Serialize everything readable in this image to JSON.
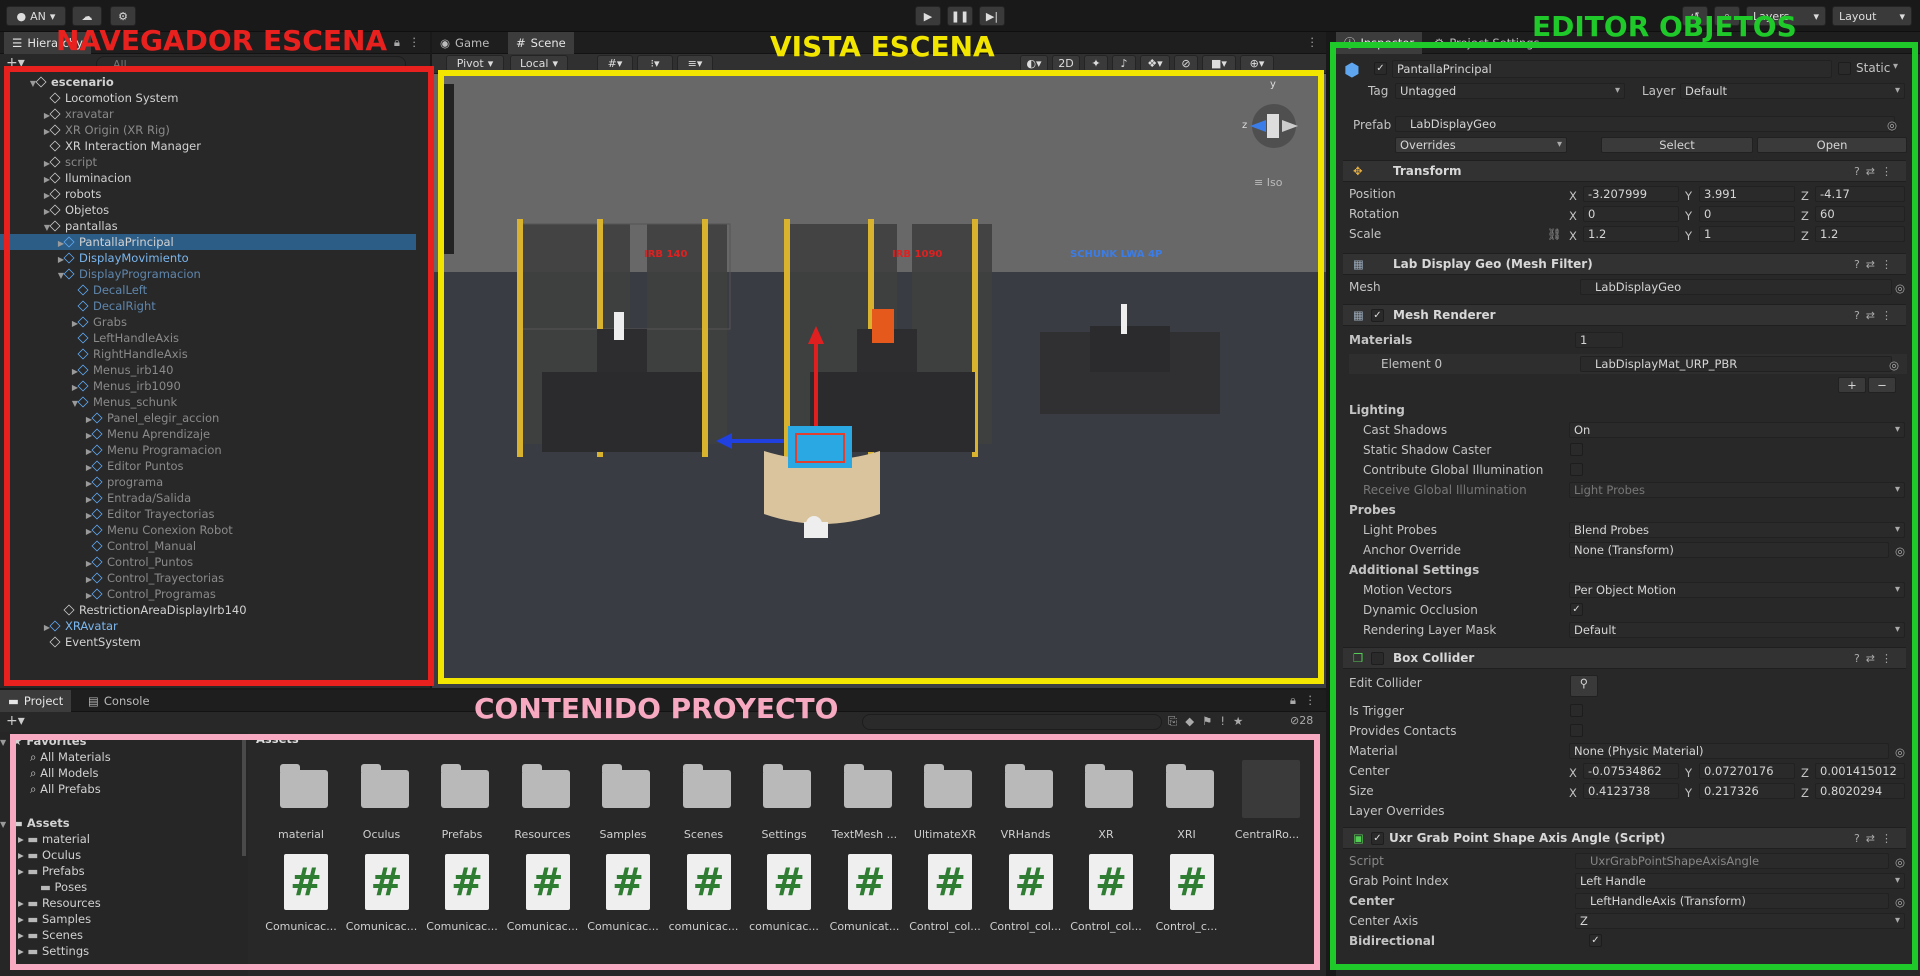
{
  "toolbar": {
    "account": "AN",
    "layers": "Layers",
    "layout": "Layout"
  },
  "hierarchy": {
    "tab": "Hierarchy",
    "search_placeholder": "All",
    "rows": [
      {
        "label": "escenario",
        "depth": 0,
        "style": "root",
        "arrow": "▼"
      },
      {
        "label": "Locomotion System",
        "depth": 1,
        "style": "",
        "arrow": ""
      },
      {
        "label": "xravatar",
        "depth": 1,
        "style": "dim",
        "arrow": "▶"
      },
      {
        "label": "XR Origin (XR Rig)",
        "depth": 1,
        "style": "dim",
        "arrow": "▶"
      },
      {
        "label": "XR Interaction Manager",
        "depth": 1,
        "style": "",
        "arrow": ""
      },
      {
        "label": "script",
        "depth": 1,
        "style": "dim",
        "arrow": "▶"
      },
      {
        "label": "Iluminacion",
        "depth": 1,
        "style": "",
        "arrow": "▶"
      },
      {
        "label": "robots",
        "depth": 1,
        "style": "",
        "arrow": "▶"
      },
      {
        "label": "Objetos",
        "depth": 1,
        "style": "",
        "arrow": "▶"
      },
      {
        "label": "pantallas",
        "depth": 1,
        "style": "",
        "arrow": "▼"
      },
      {
        "label": "PantallaPrincipal",
        "depth": 2,
        "style": "sel",
        "arrow": "▶"
      },
      {
        "label": "DisplayMovimiento",
        "depth": 2,
        "style": "pref",
        "arrow": "▶"
      },
      {
        "label": "DisplayProgramacion",
        "depth": 2,
        "style": "pdim",
        "arrow": "▼"
      },
      {
        "label": "DecalLeft",
        "depth": 3,
        "style": "pdim",
        "arrow": ""
      },
      {
        "label": "DecalRight",
        "depth": 3,
        "style": "pdim",
        "arrow": ""
      },
      {
        "label": "Grabs",
        "depth": 3,
        "style": "dim",
        "arrow": "▶"
      },
      {
        "label": "LeftHandleAxis",
        "depth": 3,
        "style": "dim",
        "arrow": ""
      },
      {
        "label": "RightHandleAxis",
        "depth": 3,
        "style": "dim",
        "arrow": ""
      },
      {
        "label": "Menus_irb140",
        "depth": 3,
        "style": "dim",
        "arrow": "▶"
      },
      {
        "label": "Menus_irb1090",
        "depth": 3,
        "style": "dim",
        "arrow": "▶"
      },
      {
        "label": "Menus_schunk",
        "depth": 3,
        "style": "dim",
        "arrow": "▼"
      },
      {
        "label": "Panel_elegir_accion",
        "depth": 4,
        "style": "dim",
        "arrow": "▶"
      },
      {
        "label": "Menu Aprendizaje",
        "depth": 4,
        "style": "dim",
        "arrow": "▶"
      },
      {
        "label": "Menu Programacion",
        "depth": 4,
        "style": "dim",
        "arrow": "▶"
      },
      {
        "label": "Editor Puntos",
        "depth": 4,
        "style": "dim",
        "arrow": "▶"
      },
      {
        "label": "programa",
        "depth": 4,
        "style": "dim",
        "arrow": "▶"
      },
      {
        "label": "Entrada/Salida",
        "depth": 4,
        "style": "dim",
        "arrow": "▶"
      },
      {
        "label": "Editor Trayectorias",
        "depth": 4,
        "style": "dim",
        "arrow": "▶"
      },
      {
        "label": "Menu Conexion Robot",
        "depth": 4,
        "style": "dim",
        "arrow": "▶"
      },
      {
        "label": "Control_Manual",
        "depth": 4,
        "style": "dim",
        "arrow": ""
      },
      {
        "label": "Control_Puntos",
        "depth": 4,
        "style": "dim",
        "arrow": "▶"
      },
      {
        "label": "Control_Trayectorias",
        "depth": 4,
        "style": "dim",
        "arrow": "▶"
      },
      {
        "label": "Control_Programas",
        "depth": 4,
        "style": "dim",
        "arrow": "▶"
      },
      {
        "label": "RestrictionAreaDisplayIrb140",
        "depth": 2,
        "style": "",
        "arrow": ""
      },
      {
        "label": "XRAvatar",
        "depth": 1,
        "style": "pref",
        "arrow": "▶"
      },
      {
        "label": "EventSystem",
        "depth": 1,
        "style": "",
        "arrow": ""
      }
    ]
  },
  "scene": {
    "tab_game": "Game",
    "tab_scene": "Scene",
    "pivot": "Pivot",
    "local": "Local",
    "mode_2d": "2D",
    "iso": "Iso",
    "gizmo_y": "y",
    "gizmo_z": "z",
    "labels": [
      "IRB 140",
      "IRB 1090",
      "SCHUNK LWA 4P"
    ]
  },
  "inspector": {
    "tab": "Inspector",
    "tab2": "Project Settings",
    "object_name": "PantallaPrincipal",
    "static": "Static",
    "tag_label": "Tag",
    "tag": "Untagged",
    "layer_label": "Layer",
    "layer": "Default",
    "prefab_label": "Prefab",
    "prefab": "LabDisplayGeo",
    "overrides": "Overrides",
    "select": "Select",
    "open": "Open",
    "transform": {
      "title": "Transform",
      "position_label": "Position",
      "px": "-3.207999",
      "py": "3.991",
      "pz": "-4.17",
      "rotation_label": "Rotation",
      "rx": "0",
      "ry": "0",
      "rz": "60",
      "scale_label": "Scale",
      "sx": "1.2",
      "sy": "1",
      "sz": "1.2"
    },
    "mesh_filter": {
      "title": "Lab Display Geo (Mesh Filter)",
      "mesh_label": "Mesh",
      "mesh": "LabDisplayGeo"
    },
    "mesh_renderer": {
      "title": "Mesh Renderer",
      "materials_label": "Materials",
      "materials_count": "1",
      "element_label": "Element 0",
      "element": "LabDisplayMat_URP_PBR",
      "lighting": "Lighting",
      "cast_shadows_label": "Cast Shadows",
      "cast_shadows": "On",
      "static_shadow_label": "Static Shadow Caster",
      "gi_label": "Contribute Global Illumination",
      "receive_gi_label": "Receive Global Illumination",
      "receive_gi": "Light Probes",
      "probes": "Probes",
      "light_probes_label": "Light Probes",
      "light_probes": "Blend Probes",
      "anchor_label": "Anchor Override",
      "anchor": "None (Transform)",
      "additional": "Additional Settings",
      "motion_label": "Motion Vectors",
      "motion": "Per Object Motion",
      "occlusion_label": "Dynamic Occlusion",
      "rlm_label": "Rendering Layer Mask",
      "rlm": "Default"
    },
    "box_collider": {
      "title": "Box Collider",
      "edit_label": "Edit Collider",
      "trigger_label": "Is Trigger",
      "contacts_label": "Provides Contacts",
      "material_label": "Material",
      "material": "None (Physic Material)",
      "center_label": "Center",
      "cx": "-0.07534862",
      "cy": "0.07270176",
      "cz": "0.001415012",
      "size_label": "Size",
      "sx": "0.4123738",
      "sy": "0.217326",
      "sz": "0.8020294",
      "layer_overrides": "Layer Overrides"
    },
    "grab_script": {
      "title": "Uxr Grab Point Shape Axis Angle (Script)",
      "script_label": "Script",
      "script": "UxrGrabPointShapeAxisAngle",
      "index_label": "Grab Point Index",
      "index": "Left Handle",
      "center_label": "Center",
      "center": "LeftHandleAxis (Transform)",
      "axis_label": "Center Axis",
      "axis": "Z",
      "bidir_label": "Bidirectional"
    }
  },
  "project": {
    "tab": "Project",
    "tab2": "Console",
    "hidden_count": "28",
    "favorites": "Favorites",
    "fav_items": [
      "All Materials",
      "All Models",
      "All Prefabs"
    ],
    "assets_root": "Assets",
    "tree": [
      {
        "label": "material",
        "depth": 1
      },
      {
        "label": "Oculus",
        "depth": 1
      },
      {
        "label": "Prefabs",
        "depth": 1
      },
      {
        "label": "Poses",
        "depth": 2
      },
      {
        "label": "Resources",
        "depth": 1
      },
      {
        "label": "Samples",
        "depth": 1
      },
      {
        "label": "Scenes",
        "depth": 1
      },
      {
        "label": "Settings",
        "depth": 1
      }
    ],
    "breadcrumb": "Assets",
    "folders": [
      "material",
      "Oculus",
      "Prefabs",
      "Resources",
      "Samples",
      "Scenes",
      "Settings",
      "TextMesh ...",
      "UltimateXR",
      "VRHands",
      "XR",
      "XRI",
      "CentralRo..."
    ],
    "scripts": [
      "Comunicac...",
      "Comunicac...",
      "Comunicac...",
      "Comunicac...",
      "Comunicac...",
      "comunicac...",
      "comunicac...",
      "Comunicat...",
      "Control_col...",
      "Control_col...",
      "Control_col...",
      "Control_c..."
    ]
  },
  "annotations": {
    "nav": "NAVEGADOR ESCENA",
    "view": "VISTA ESCENA",
    "editor": "EDITOR OBJETOS",
    "content": "CONTENIDO PROYECTO",
    "colors": {
      "nav": "#e8211f",
      "view": "#f2e600",
      "editor": "#1fc92a",
      "content": "#f7a9c2"
    }
  }
}
